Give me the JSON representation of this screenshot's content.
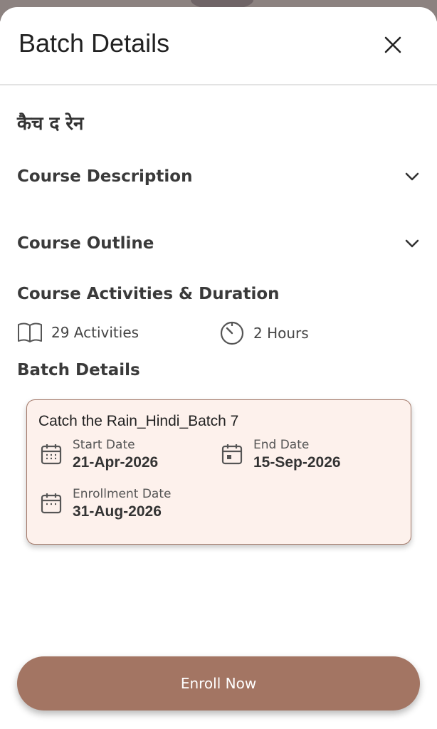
{
  "header": {
    "title": "Batch Details"
  },
  "course": {
    "title": "कैच द रेन"
  },
  "sections": {
    "description_label": "Course Description",
    "outline_label": "Course Outline",
    "activities_heading": "Course Activities & Duration",
    "batch_heading": "Batch Details"
  },
  "stats": {
    "activities": "29 Activities",
    "duration": "2 Hours"
  },
  "batch": {
    "name": "Catch the Rain_Hindi_Batch 7",
    "start_label": "Start Date",
    "start_value": "21-Apr-2026",
    "end_label": "End Date",
    "end_value": "15-Sep-2026",
    "enrollment_label": "Enrollment Date",
    "enrollment_value": "31-Aug-2026"
  },
  "actions": {
    "enroll_label": "Enroll Now"
  },
  "colors": {
    "accent": "#a37563",
    "card_bg": "#fdf1ec",
    "card_border": "#a37868"
  },
  "icons": {
    "close": "close-icon",
    "expand": "chevron-down-icon",
    "activities": "book-icon",
    "duration": "timer-icon",
    "date": "calendar-icon"
  }
}
